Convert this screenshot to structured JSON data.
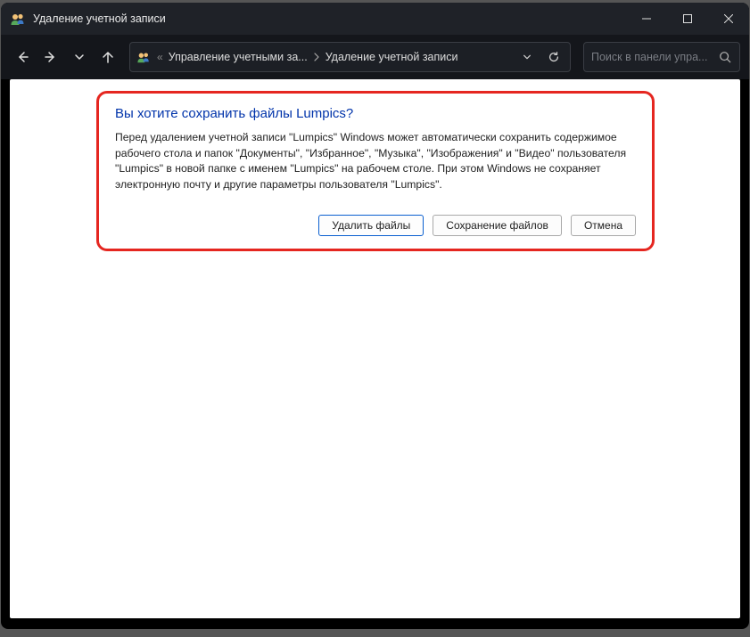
{
  "window": {
    "title": "Удаление учетной записи"
  },
  "breadcrumb": {
    "prefix": "«",
    "item1": "Управление учетными за...",
    "item2": "Удаление учетной записи"
  },
  "search": {
    "placeholder": "Поиск в панели упра..."
  },
  "dialog": {
    "title": "Вы хотите сохранить файлы Lumpics?",
    "body": "Перед удалением учетной записи \"Lumpics\" Windows может автоматически сохранить содержимое рабочего стола и папок \"Документы\", \"Избранное\", \"Музыка\", \"Изображения\" и \"Видео\" пользователя \"Lumpics\" в новой папке с именем \"Lumpics\" на рабочем столе. При этом Windows не сохраняет электронную почту и другие параметры пользователя \"Lumpics\".",
    "buttons": {
      "delete": "Удалить файлы",
      "save": "Сохранение файлов",
      "cancel": "Отмена"
    }
  }
}
